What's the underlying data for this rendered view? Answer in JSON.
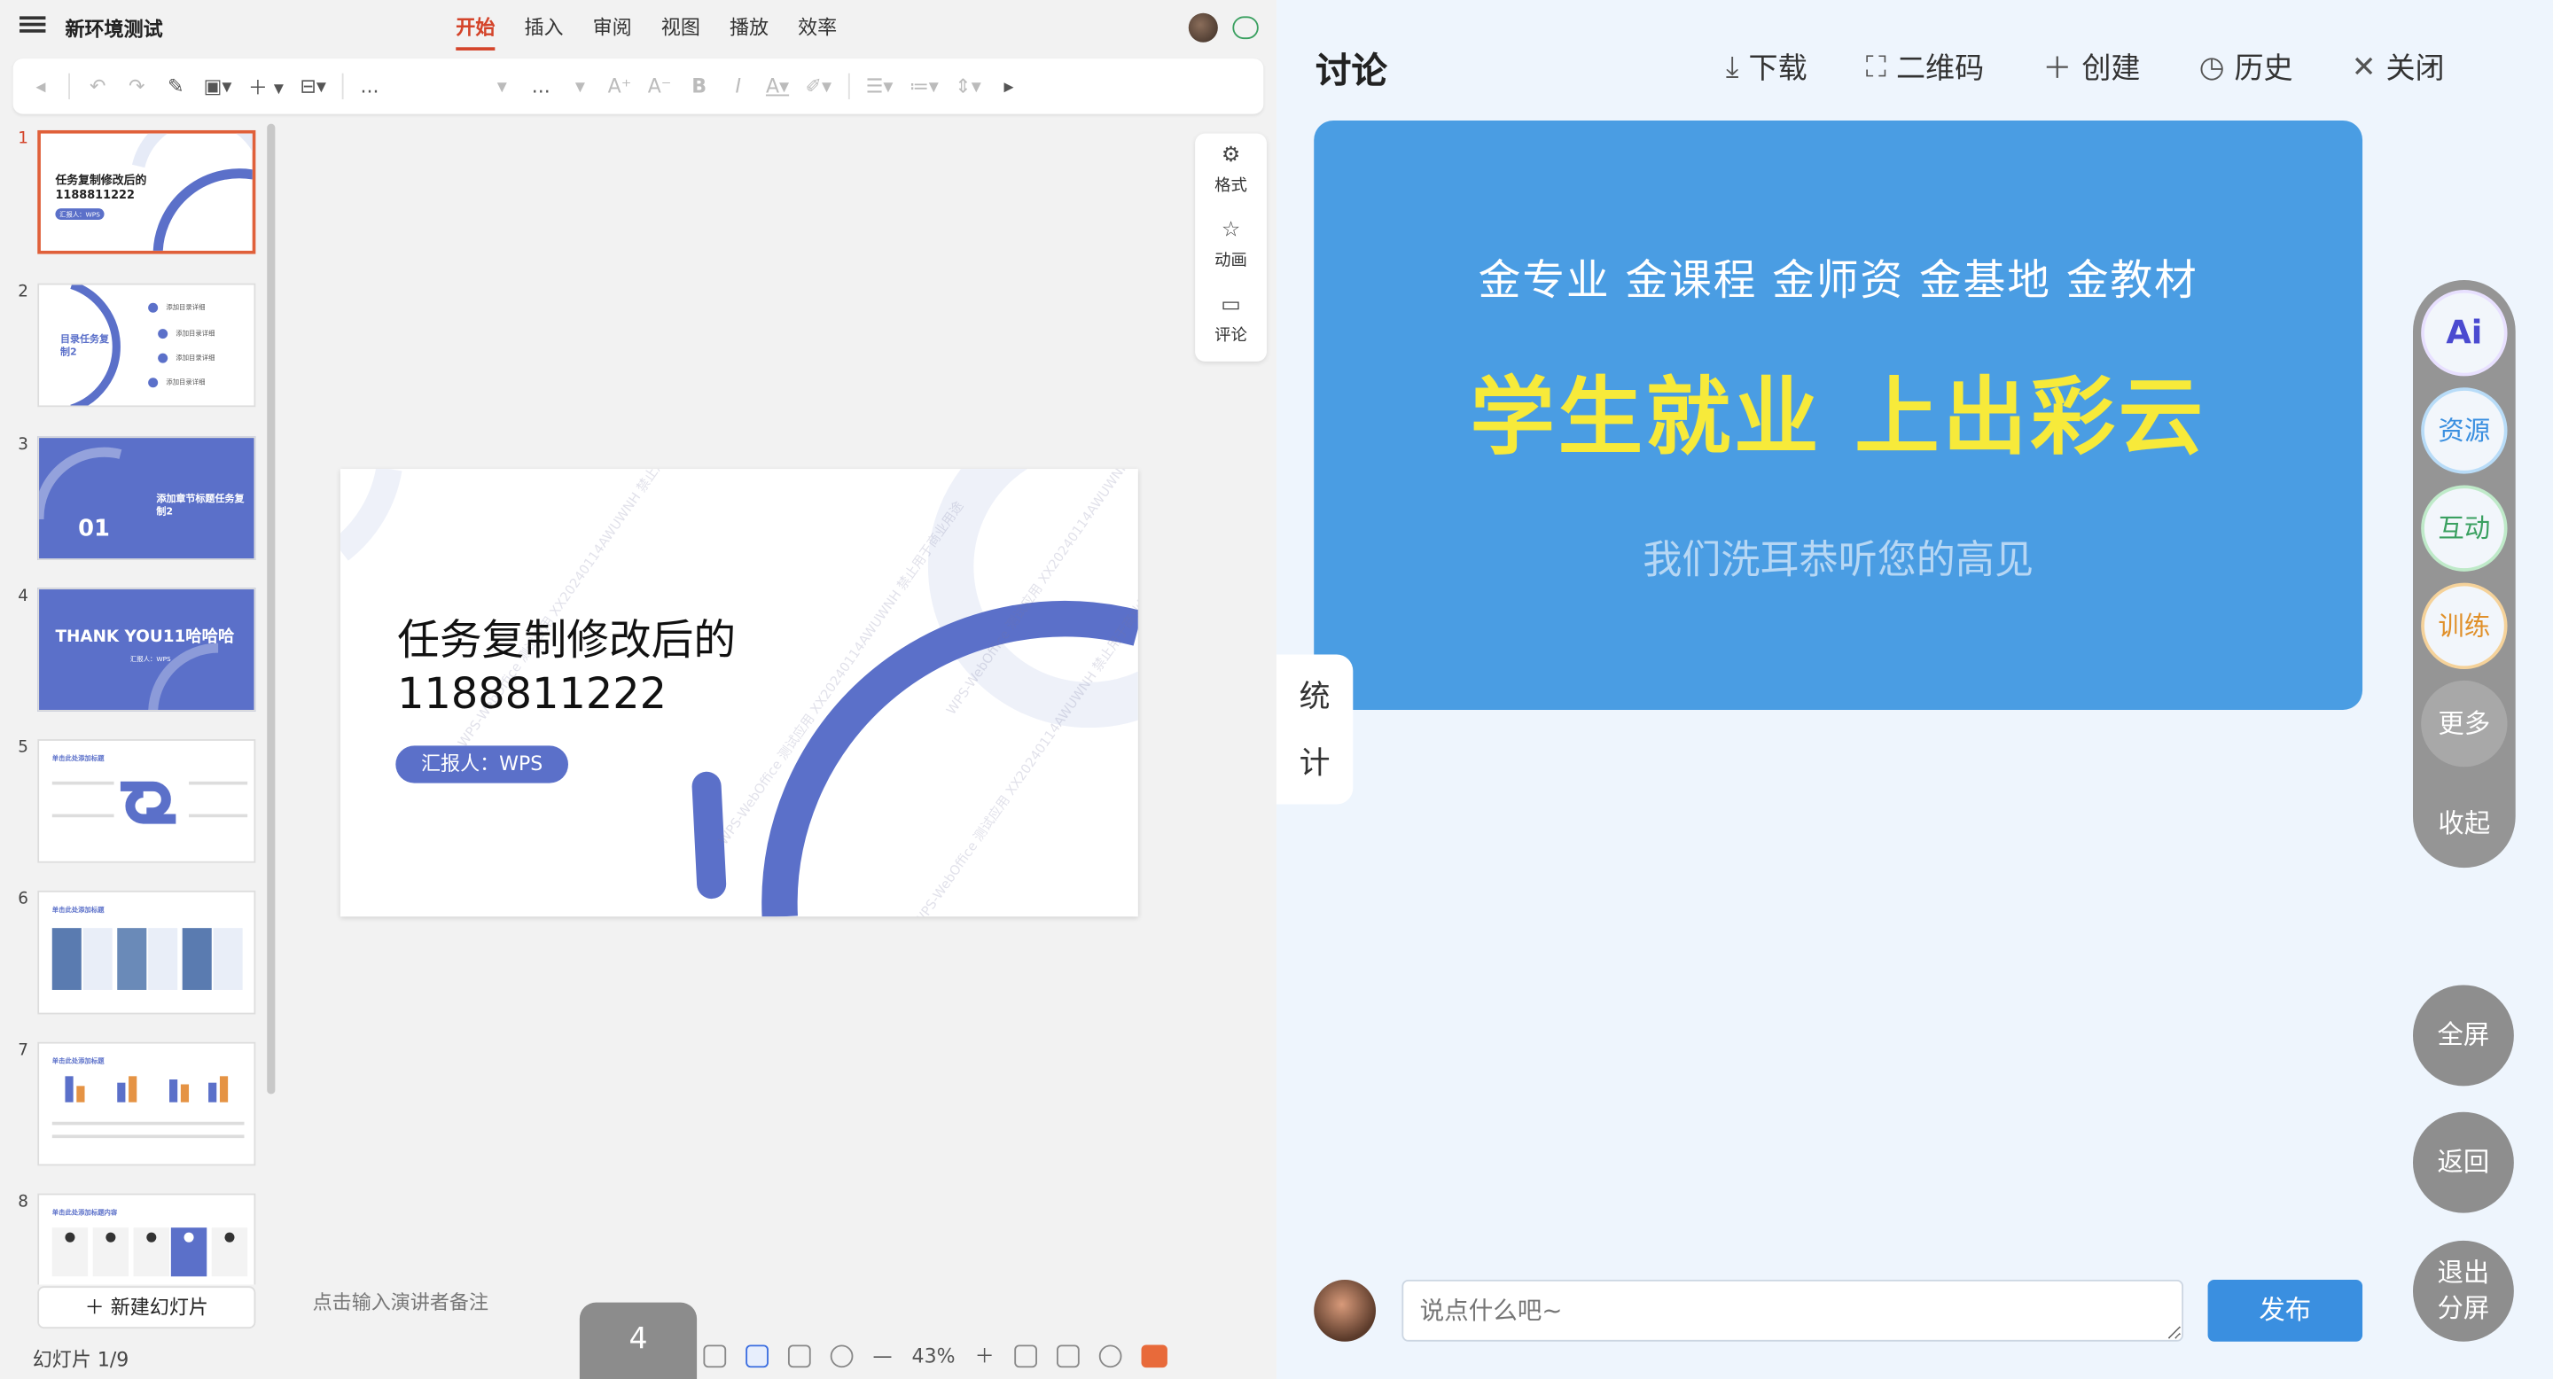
{
  "window": {
    "title": "新环境测试",
    "tabs": [
      {
        "label": "开始",
        "active": true
      },
      {
        "label": "插入"
      },
      {
        "label": "审阅"
      },
      {
        "label": "视图"
      },
      {
        "label": "播放"
      },
      {
        "label": "效率"
      }
    ]
  },
  "toolbar": {
    "font_name": "...",
    "font_size": "...",
    "icons": [
      "back-icon",
      "undo-icon",
      "redo-icon",
      "format-painter-icon",
      "slide-layout-icon",
      "add-icon",
      "textbox-icon",
      "font-enlarge-icon",
      "font-shrink-icon",
      "bold-icon",
      "italic-icon",
      "font-color-icon",
      "highlight-icon",
      "align-icon",
      "list-icon",
      "line-spacing-icon",
      "more-icon"
    ]
  },
  "side_tools": [
    {
      "label": "格式",
      "icon": "gear-icon"
    },
    {
      "label": "动画",
      "icon": "star-icon"
    },
    {
      "label": "评论",
      "icon": "comment-icon"
    }
  ],
  "thumbnails": [
    {
      "num": "1",
      "title": "任务复制修改后的 1188811222",
      "pill": "汇报人：WPS",
      "selected": true
    },
    {
      "num": "2",
      "title": "目录任务复制2",
      "items": [
        "添加目录详细",
        "添加目录详细",
        "添加目录详细",
        "添加目录详细"
      ]
    },
    {
      "num": "3",
      "title": "添加章节标题任务复制2",
      "big": "01"
    },
    {
      "num": "4",
      "title": "THANK YOU11哈哈哈",
      "pill": "汇报人：WPS"
    },
    {
      "num": "5",
      "title": "单击此处添加标题"
    },
    {
      "num": "6",
      "title": "单击此处添加标题"
    },
    {
      "num": "7",
      "title": "单击此处添加标题"
    },
    {
      "num": "8",
      "title": "单击此处添加标题内容"
    }
  ],
  "new_slide_label": "＋ 新建幻灯片",
  "status": {
    "slide_count": "幻灯片 1/9",
    "notes_placeholder": "点击输入演讲者备注",
    "zoom": "43%",
    "page_badge": "4"
  },
  "slide": {
    "title_line1": "任务复制修改后的",
    "title_line2": "1188811222",
    "reporter": "汇报人：WPS",
    "watermark": "WPS-WebOffice 测试应用 XX20240114AWUWNH 禁止用于商业用途"
  },
  "panel": {
    "title": "讨论",
    "actions": [
      {
        "label": "下载",
        "icon": "download-icon",
        "glyph": "⤓"
      },
      {
        "label": "二维码",
        "icon": "qrcode-scan-icon",
        "glyph": "⛶"
      },
      {
        "label": "创建",
        "icon": "plus-icon",
        "glyph": "＋"
      },
      {
        "label": "历史",
        "icon": "history-icon",
        "glyph": "◷"
      },
      {
        "label": "关闭",
        "icon": "close-icon",
        "glyph": "✕"
      }
    ],
    "banner": {
      "line1": "金专业  金课程  金师资  金基地  金教材",
      "line2": "学生就业  上出彩云",
      "line3": "我们洗耳恭听您的高见",
      "bg": "#4a9de3",
      "headline_color": "#f7ea3a"
    },
    "stat_tab": [
      "统",
      "计"
    ],
    "rail": {
      "ai": "Ai",
      "resources": "资源",
      "interact": "互动",
      "train": "训练",
      "more": "更多",
      "collapse": "收起"
    },
    "round_buttons": [
      "全屏",
      "返回",
      "退出\n分屏"
    ],
    "comment_placeholder": "说点什么吧~",
    "publish_label": "发布"
  }
}
